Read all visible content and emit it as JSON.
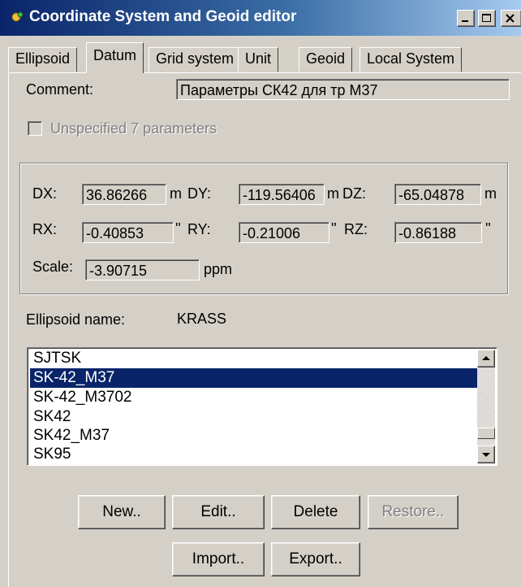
{
  "window": {
    "title": "Coordinate System and Geoid editor",
    "controls": {
      "minimize": "_",
      "maximize": "□",
      "close": "×"
    }
  },
  "tabs": [
    "Ellipsoid",
    "Datum",
    "Grid system",
    "Unit",
    "Geoid",
    "Local System"
  ],
  "active_tab": "Datum",
  "comment": {
    "label": "Comment:",
    "value": "Параметры СК42 для тр М37"
  },
  "unspecified": {
    "label": "Unspecified 7 parameters",
    "checked": false,
    "enabled": false
  },
  "params": {
    "dx": {
      "label": "DX:",
      "value": "36.86266",
      "unit": "m"
    },
    "dy": {
      "label": "DY:",
      "value": "-119.56406",
      "unit": "m"
    },
    "dz": {
      "label": "DZ:",
      "value": "-65.04878",
      "unit": "m"
    },
    "rx": {
      "label": "RX:",
      "value": "-0.40853",
      "unit": "''"
    },
    "ry": {
      "label": "RY:",
      "value": "-0.21006",
      "unit": "''"
    },
    "rz": {
      "label": "RZ:",
      "value": "-0.86188",
      "unit": "''"
    },
    "scale": {
      "label": "Scale:",
      "value": "-3.90715",
      "unit": "ppm"
    }
  },
  "ellipsoid": {
    "label": "Ellipsoid name:",
    "value": "KRASS"
  },
  "datum_list": {
    "items": [
      "SJTSK",
      "SK-42_M37",
      "SK-42_M3702",
      "SK42",
      "SK42_M37",
      "SK95"
    ],
    "selected": "SK-42_M37"
  },
  "buttons": {
    "new": "New..",
    "edit": "Edit..",
    "delete": "Delete",
    "restore": "Restore..",
    "import": "Import..",
    "export": "Export.."
  },
  "colors": {
    "titlebar_start": "#0a246a",
    "titlebar_end": "#a6caf0",
    "selection": "#0a246a",
    "face": "#d4d0c8"
  }
}
